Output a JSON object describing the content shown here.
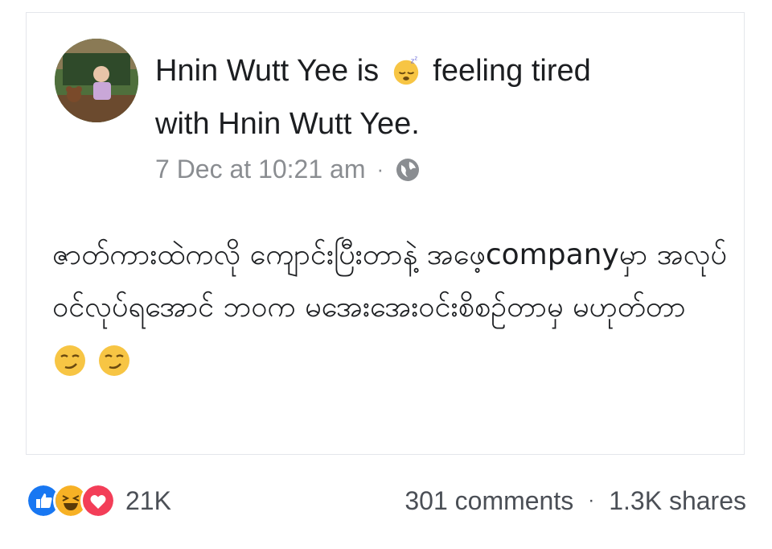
{
  "post": {
    "author": "Hnin Wutt Yee",
    "is_text": "is",
    "feeling": "feeling tired",
    "with_text": "with Hnin Wutt Yee.",
    "timestamp": "7 Dec at 10:21 am",
    "separator": "·",
    "privacy_icon": "globe-icon",
    "feeling_icon": "sleepy-face-icon",
    "body": "ဇာတ်ကားထဲကလို ကျောင်းပြီးတာနဲ့ အဖေ့companyမှာ အလုပ်ဝင်လုပ်ရအောင် ဘဝက မအေးအေးဝင်းစိစဉ်တာမှ မဟုတ်တာ",
    "body_emoji": "smirking-face-icon"
  },
  "footer": {
    "reaction_icons": [
      "like-icon",
      "haha-icon",
      "love-icon"
    ],
    "reaction_count": "21K",
    "comments": "301 comments",
    "separator": "·",
    "shares": "1.3K shares"
  },
  "colors": {
    "like": "#1877f2",
    "love": "#f33e58",
    "haha": "#f7b125",
    "meta_gray": "#8a8d91"
  }
}
